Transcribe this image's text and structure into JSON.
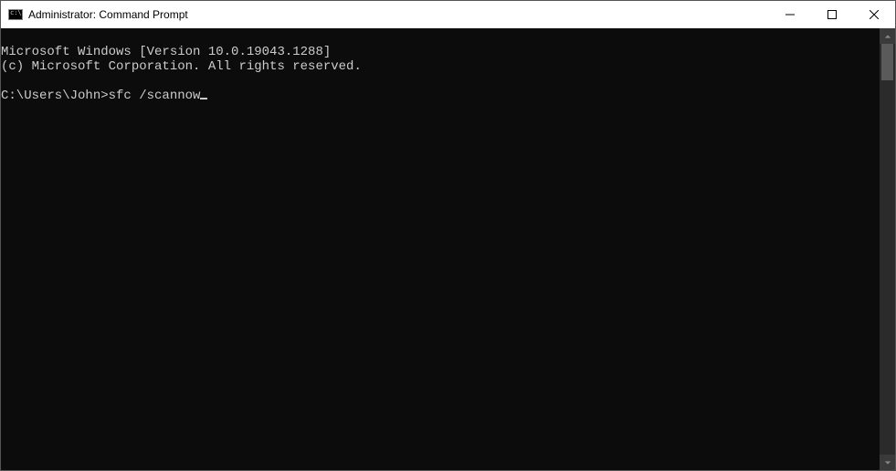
{
  "window": {
    "title": "Administrator: Command Prompt"
  },
  "terminal": {
    "line1": "Microsoft Windows [Version 10.0.19043.1288]",
    "line2": "(c) Microsoft Corporation. All rights reserved.",
    "blank": "",
    "prompt": "C:\\Users\\John>",
    "command": "sfc /scannow"
  }
}
